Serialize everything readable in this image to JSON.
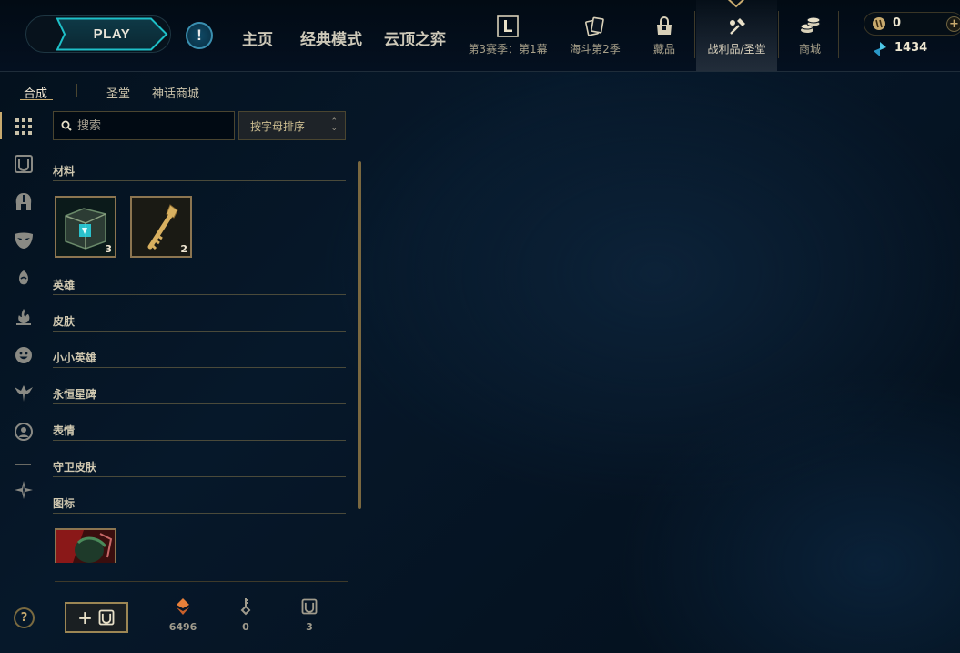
{
  "header": {
    "play_label": "PLAY",
    "alert_symbol": "!",
    "nav": [
      "主页",
      "经典模式",
      "云顶之弈"
    ],
    "icon_tabs": [
      {
        "label": "第3赛季：第1幕",
        "icon": "ranked-l-icon"
      },
      {
        "label": "海斗第2季",
        "icon": "cards-icon"
      },
      {
        "label": "藏品",
        "icon": "collection-bag-icon"
      },
      {
        "label": "战利品/圣堂",
        "icon": "loot-hammer-icon",
        "active": true
      },
      {
        "label": "商城",
        "icon": "store-coins-icon"
      }
    ],
    "currency": {
      "rp": "0",
      "blue_essence": "1434",
      "add_symbol": "+"
    }
  },
  "subnav": {
    "items": [
      "合成",
      "圣堂",
      "神话商城"
    ],
    "active": "合成"
  },
  "left_rail": {
    "icons": [
      "grid-icon",
      "chest-icon",
      "champion-helmet-icon",
      "skin-mask-icon",
      "tiny-legend-icon",
      "eternals-flame-icon",
      "emote-face-icon",
      "ward-skin-icon",
      "profile-icon",
      "summoner-icon"
    ]
  },
  "toolbar": {
    "search_placeholder": "搜索",
    "sort_label": "按字母排序"
  },
  "categories": [
    {
      "name": "材料",
      "items": [
        {
          "icon": "hextech-chest-icon",
          "count": "3"
        },
        {
          "icon": "hextech-key-icon",
          "count": "2"
        }
      ]
    },
    {
      "name": "英雄"
    },
    {
      "name": "皮肤"
    },
    {
      "name": "小小英雄"
    },
    {
      "name": "永恒星碑"
    },
    {
      "name": "表情"
    },
    {
      "name": "守卫皮肤"
    },
    {
      "name": "图标",
      "items": [
        {
          "icon": "summoner-icon-art"
        }
      ]
    }
  ],
  "footer": {
    "craft_symbol": "+",
    "wallet": [
      {
        "icon": "orange-essence-icon",
        "value": "6496"
      },
      {
        "icon": "key-fragment-icon",
        "value": "0"
      },
      {
        "icon": "chest-small-icon",
        "value": "3"
      }
    ],
    "help_symbol": "?"
  },
  "colors": {
    "gold": "#c8aa6e",
    "accent_teal": "#0ac8b9",
    "background": "#06182a"
  }
}
